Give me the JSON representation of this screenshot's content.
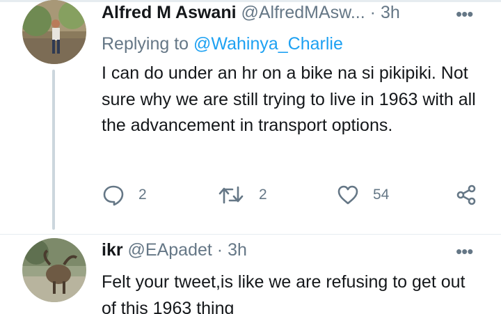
{
  "tweet1": {
    "name": "Alfred M Aswani",
    "handle": "@AlfredMAsw...",
    "dot": "·",
    "time": "3h",
    "more": "•••",
    "reply_prefix": "Replying to",
    "reply_to": "@Wahinya_Charlie",
    "text": "I can do under an hr on a bike na si pikipiki. Not sure why we are still trying to live in 1963 with all the advancement in transport options.",
    "reply_count": "2",
    "retweet_count": "2",
    "like_count": "54"
  },
  "tweet2": {
    "name": "ikr",
    "handle": "@EApadet",
    "dot": "·",
    "time": "3h",
    "more": "•••",
    "text": "Felt your tweet,is like we are refusing to get out of this 1963 thing"
  },
  "colors": {
    "text": "#14171a",
    "secondary": "#657786",
    "link": "#1da1f2",
    "thread": "#ccd6dd"
  },
  "icons": [
    "reply-icon",
    "retweet-icon",
    "like-icon",
    "share-icon",
    "more-icon"
  ]
}
